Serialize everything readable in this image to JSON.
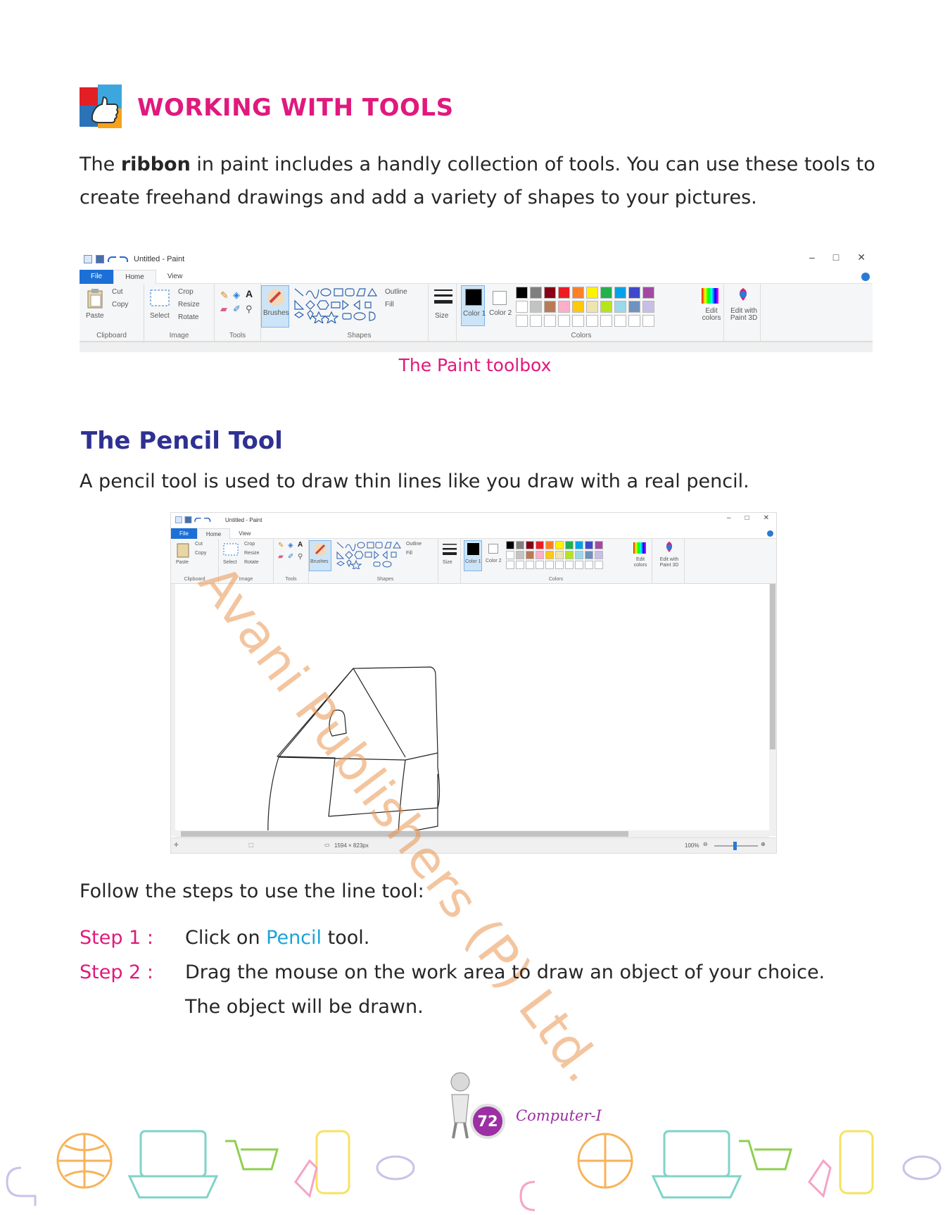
{
  "heading": {
    "title": "WORKING WITH TOOLS"
  },
  "intro": {
    "before": "The ",
    "bold": "ribbon",
    "after_line1": " in paint includes a handly collection of tools. You can use these tools to",
    "line2": "create freehand drawings and add a  variety of shapes to your pictures."
  },
  "paint_window": {
    "title": "Untitled - Paint",
    "tabs": [
      "File",
      "Home",
      "View"
    ],
    "clipboard": {
      "paste": "Paste",
      "cut": "Cut",
      "copy": "Copy",
      "group": "Clipboard"
    },
    "image": {
      "select": "Select",
      "crop": "Crop",
      "resize": "Resize",
      "rotate": "Rotate",
      "group": "Image"
    },
    "tools": {
      "group": "Tools",
      "brushes": "Brushes"
    },
    "shapes": {
      "group": "Shapes",
      "outline": "Outline",
      "fill": "Fill"
    },
    "size": "Size",
    "color1": "Color 1",
    "color2": "Color 2",
    "colors_group": "Colors",
    "edit_colors": "Edit colors",
    "edit_paint3d": "Edit with Paint 3D",
    "palette": [
      "#000000",
      "#7f7f7f",
      "#880015",
      "#ed1c24",
      "#ff7f27",
      "#fff200",
      "#22b14c",
      "#00a2e8",
      "#3f48cc",
      "#a349a4",
      "#ffffff",
      "#c3c3c3",
      "#b97a57",
      "#ffaec9",
      "#ffc90e",
      "#efe4b0",
      "#b5e61d",
      "#99d9ea",
      "#7092be",
      "#c8bfe7"
    ]
  },
  "caption": "The Paint toolbox",
  "pencil": {
    "heading": "The Pencil Tool",
    "desc": "A pencil tool is used to draw thin lines like you draw with a real pencil.",
    "status_dims": "1594 × 823px",
    "zoom": "100%"
  },
  "steps": {
    "intro": "Follow the steps to use the line tool:",
    "items": [
      {
        "label": "Step 1 :",
        "pre": "Click on ",
        "highlight": "Pencil",
        "post": " tool."
      },
      {
        "label": "Step 2 :",
        "text": "Drag the mouse on the work area to draw an object of your choice."
      },
      {
        "label": "",
        "text": "The object will be drawn."
      }
    ]
  },
  "watermark": "Avani Publishers (P) Ltd.",
  "footer": {
    "page_number": "72",
    "book": "Computer-I"
  }
}
